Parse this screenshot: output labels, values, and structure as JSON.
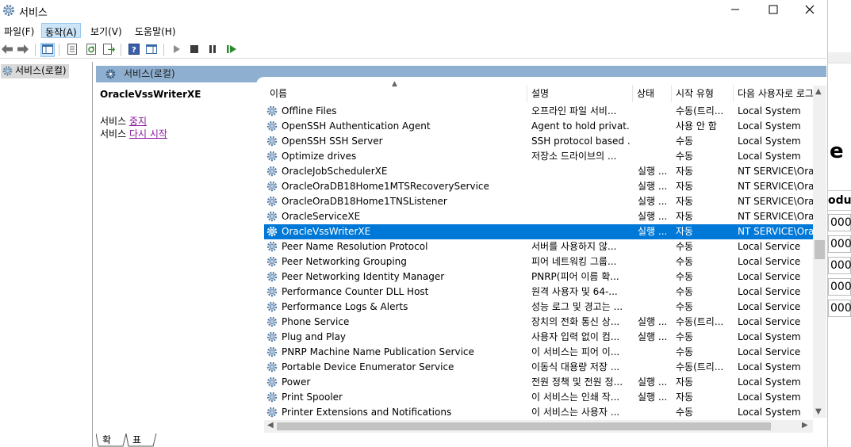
{
  "window": {
    "title": "서비스",
    "icon": "gear-services-icon",
    "minimize_icon": "minimize-icon",
    "maximize_icon": "maximize-icon",
    "close_icon": "close-icon"
  },
  "menubar": {
    "items": [
      {
        "label": "파일(F)"
      },
      {
        "label": "동작(A)",
        "active": true
      },
      {
        "label": "보기(V)"
      },
      {
        "label": "도움말(H)"
      }
    ]
  },
  "toolbar": {
    "buttons": [
      "back-icon",
      "forward-icon",
      "show-hide-console-tree-icon",
      "properties-icon",
      "refresh-icon",
      "export-list-icon",
      "help-icon",
      "show-hide-action-pane-icon",
      "start-service-icon",
      "stop-service-icon",
      "pause-service-icon",
      "restart-service-icon"
    ]
  },
  "tree": {
    "root_label": "서비스(로컬)"
  },
  "panel": {
    "header": "서비스(로컬)"
  },
  "extended": {
    "service_name": "OracleVssWriterXE",
    "line1_prefix": "서비스 ",
    "line1_link": "중지",
    "line2_prefix": "서비스 ",
    "line2_link": "다시 시작"
  },
  "columns": {
    "name": "이름",
    "description": "설명",
    "status": "상태",
    "startup_type": "시작 유형",
    "logon_as": "다음 사용자로 로그"
  },
  "services": [
    {
      "name": "Offline Files",
      "description": "오프라인 파일 서비...",
      "status": "",
      "startup": "수동(트리...",
      "logon": "Local System"
    },
    {
      "name": "OpenSSH Authentication Agent",
      "description": "Agent to hold privat...",
      "status": "",
      "startup": "사용 안 함",
      "logon": "Local System"
    },
    {
      "name": "OpenSSH SSH Server",
      "description": "SSH protocol based ...",
      "status": "",
      "startup": "수동",
      "logon": "Local System"
    },
    {
      "name": "Optimize drives",
      "description": "저장소 드라이브의 ...",
      "status": "",
      "startup": "수동",
      "logon": "Local System"
    },
    {
      "name": "OracleJobSchedulerXE",
      "description": "",
      "status": "실행 ...",
      "startup": "자동",
      "logon": "NT SERVICE\\Orac"
    },
    {
      "name": "OracleOraDB18Home1MTSRecoveryService",
      "description": "",
      "status": "실행 ...",
      "startup": "자동",
      "logon": "NT SERVICE\\Orac"
    },
    {
      "name": "OracleOraDB18Home1TNSListener",
      "description": "",
      "status": "실행 ...",
      "startup": "자동",
      "logon": "NT SERVICE\\Orac"
    },
    {
      "name": "OracleServiceXE",
      "description": "",
      "status": "실행 ...",
      "startup": "자동",
      "logon": "NT SERVICE\\Orac"
    },
    {
      "name": "OracleVssWriterXE",
      "description": "",
      "status": "실행 ...",
      "startup": "자동",
      "logon": "NT SERVICE\\Orac",
      "selected": true
    },
    {
      "name": "Peer Name Resolution Protocol",
      "description": "서버를 사용하지 않...",
      "status": "",
      "startup": "수동",
      "logon": "Local Service"
    },
    {
      "name": "Peer Networking Grouping",
      "description": "피어 네트워킹 그룹...",
      "status": "",
      "startup": "수동",
      "logon": "Local Service"
    },
    {
      "name": "Peer Networking Identity Manager",
      "description": "PNRP(피어 이름 확...",
      "status": "",
      "startup": "수동",
      "logon": "Local Service"
    },
    {
      "name": "Performance Counter DLL Host",
      "description": "원격 사용자 및 64-...",
      "status": "",
      "startup": "수동",
      "logon": "Local Service"
    },
    {
      "name": "Performance Logs & Alerts",
      "description": "성능 로그 및 경고는 ...",
      "status": "",
      "startup": "수동",
      "logon": "Local Service"
    },
    {
      "name": "Phone Service",
      "description": "장치의 전화 통신 상...",
      "status": "실행 ...",
      "startup": "수동(트리...",
      "logon": "Local Service"
    },
    {
      "name": "Plug and Play",
      "description": "사용자 입력 없이 컴...",
      "status": "실행 ...",
      "startup": "수동",
      "logon": "Local System"
    },
    {
      "name": "PNRP Machine Name Publication Service",
      "description": "이 서비스는 피어 이...",
      "status": "",
      "startup": "수동",
      "logon": "Local Service"
    },
    {
      "name": "Portable Device Enumerator Service",
      "description": "이동식 대용량 저장 ...",
      "status": "",
      "startup": "수동(트리...",
      "logon": "Local System"
    },
    {
      "name": "Power",
      "description": "전원 정책 및 전원 정...",
      "status": "실행 ...",
      "startup": "자동",
      "logon": "Local System"
    },
    {
      "name": "Print Spooler",
      "description": "이 서비스는 인쇄 작...",
      "status": "실행 ...",
      "startup": "자동",
      "logon": "Local System"
    },
    {
      "name": "Printer Extensions and Notifications",
      "description": "이 서비스는 사용자 ...",
      "status": "",
      "startup": "수동",
      "logon": "Local System"
    }
  ],
  "tabs": {
    "extended": "확장",
    "standard": "표준"
  },
  "background_window": {
    "big_letter": "e",
    "header": "odul",
    "cells": [
      "000",
      "000",
      "000",
      "000",
      "000"
    ]
  },
  "colors": {
    "selection": "#0078d7",
    "panel_header": "#8eafd0",
    "link": "#8a1a9b"
  }
}
